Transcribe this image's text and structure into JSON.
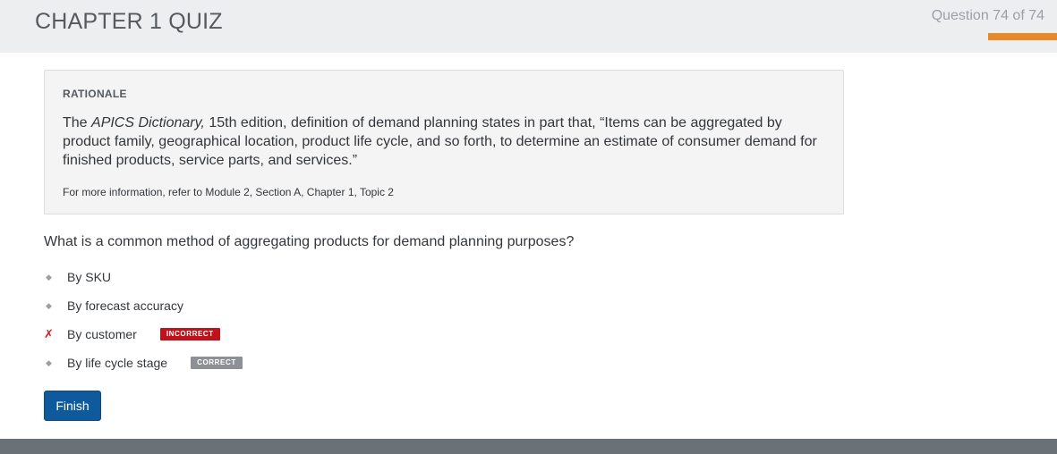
{
  "header": {
    "title": "CHAPTER 1 QUIZ",
    "progress_prefix": "Question ",
    "progress_current": "74",
    "progress_suffix": " of 74",
    "progress_fraction": 1.0
  },
  "rationale": {
    "heading": "RATIONALE",
    "text_before": "The ",
    "text_italic": "APICS Dictionary,",
    "text_after": " 15th edition, definition of demand planning states in part that, “Items can be aggregated by product family, geographical location, product life cycle, and so forth, to determine an estimate of consumer demand for finished products, service parts, and services.”",
    "reference": "For more information, refer to Module 2, Section A, Chapter 1, Topic 2"
  },
  "question": {
    "text": "What is a common method of aggregating products for demand planning purposes?",
    "options": [
      {
        "label": "By SKU",
        "marker": "◆",
        "badge": ""
      },
      {
        "label": "By forecast accuracy",
        "marker": "◆",
        "badge": ""
      },
      {
        "label": "By customer",
        "marker": "✗",
        "badge": "INCORRECT"
      },
      {
        "label": "By life cycle stage",
        "marker": "◆",
        "badge": "CORRECT"
      }
    ]
  },
  "actions": {
    "finish_label": "Finish"
  },
  "colors": {
    "accent_orange": "#e98825",
    "button_blue": "#0e5a9c",
    "incorrect_red": "#c0121b",
    "correct_gray": "#8d9095"
  }
}
